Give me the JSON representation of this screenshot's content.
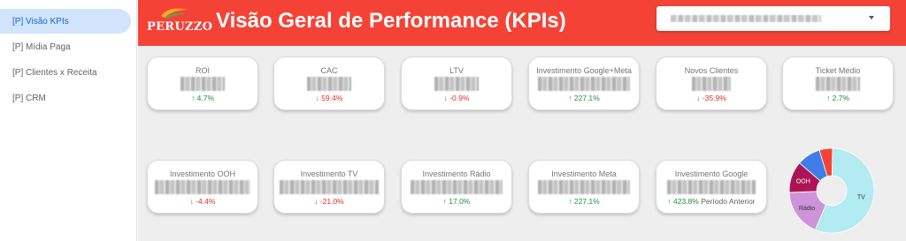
{
  "sidebar": {
    "items": [
      {
        "label": "[P] Visão KPIs",
        "active": true
      },
      {
        "label": "[P] Mídia Paga",
        "active": false
      },
      {
        "label": "[P] Clientes x Receita",
        "active": false
      },
      {
        "label": "[P] CRM",
        "active": false
      }
    ]
  },
  "header": {
    "logo_text": "PERUZZO",
    "title": "Visão Geral de Performance (KPIs)",
    "header_color": "#f44336"
  },
  "kpis": [
    {
      "label": "ROI",
      "delta": "4.7%",
      "direction": "up"
    },
    {
      "label": "CAC",
      "delta": "59.4%",
      "direction": "down"
    },
    {
      "label": "LTV",
      "delta": "-0.9%",
      "direction": "down"
    },
    {
      "label": "Investimento Google+Meta",
      "delta": "227.1%",
      "direction": "up"
    },
    {
      "label": "Novos Clientes",
      "delta": "-35.9%",
      "direction": "down"
    },
    {
      "label": "Ticket Médio",
      "delta": "2.7%",
      "direction": "up"
    },
    {
      "label": "Investimento OOH",
      "delta": "-4.4%",
      "direction": "down"
    },
    {
      "label": "Investimento TV",
      "delta": "-21.0%",
      "direction": "down"
    },
    {
      "label": "Investimento Rádio",
      "delta": "17.0%",
      "direction": "up"
    },
    {
      "label": "Investimento Meta",
      "delta": "227.1%",
      "direction": "up"
    },
    {
      "label": "Investimento Google",
      "delta": "423.8%",
      "direction": "up",
      "suffix": "Período Anterior"
    }
  ],
  "chart_data": {
    "type": "pie",
    "categories": [
      "TV",
      "Rádio",
      "OOH",
      "",
      ""
    ],
    "values": [
      56,
      18,
      12,
      9,
      5
    ],
    "colors": [
      "#b2ebf2",
      "#ce93d8",
      "#ad1457",
      "#3f7ee8",
      "#f44336"
    ]
  }
}
